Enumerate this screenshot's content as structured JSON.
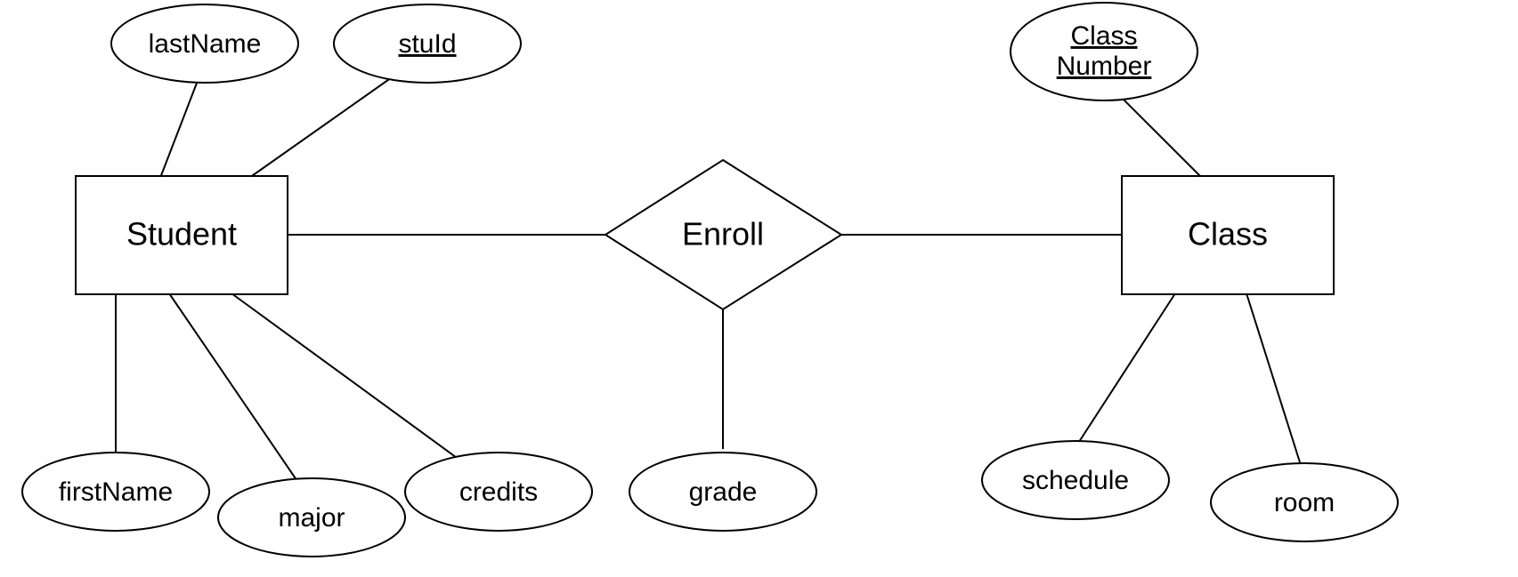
{
  "entities": {
    "student": {
      "label": "Student"
    },
    "class": {
      "label": "Class"
    }
  },
  "relationship": {
    "enroll": {
      "label": "Enroll"
    }
  },
  "attributes": {
    "lastName": {
      "label": "lastName",
      "key": false
    },
    "stuId": {
      "label": "stuId",
      "key": true
    },
    "firstName": {
      "label": "firstName",
      "key": false
    },
    "major": {
      "label": "major",
      "key": false
    },
    "credits": {
      "label": "credits",
      "key": false
    },
    "grade": {
      "label": "grade",
      "key": false
    },
    "classNumber": {
      "label1": "Class",
      "label2": "Number",
      "key": true
    },
    "schedule": {
      "label": "schedule",
      "key": false
    },
    "room": {
      "label": "room",
      "key": false
    }
  }
}
